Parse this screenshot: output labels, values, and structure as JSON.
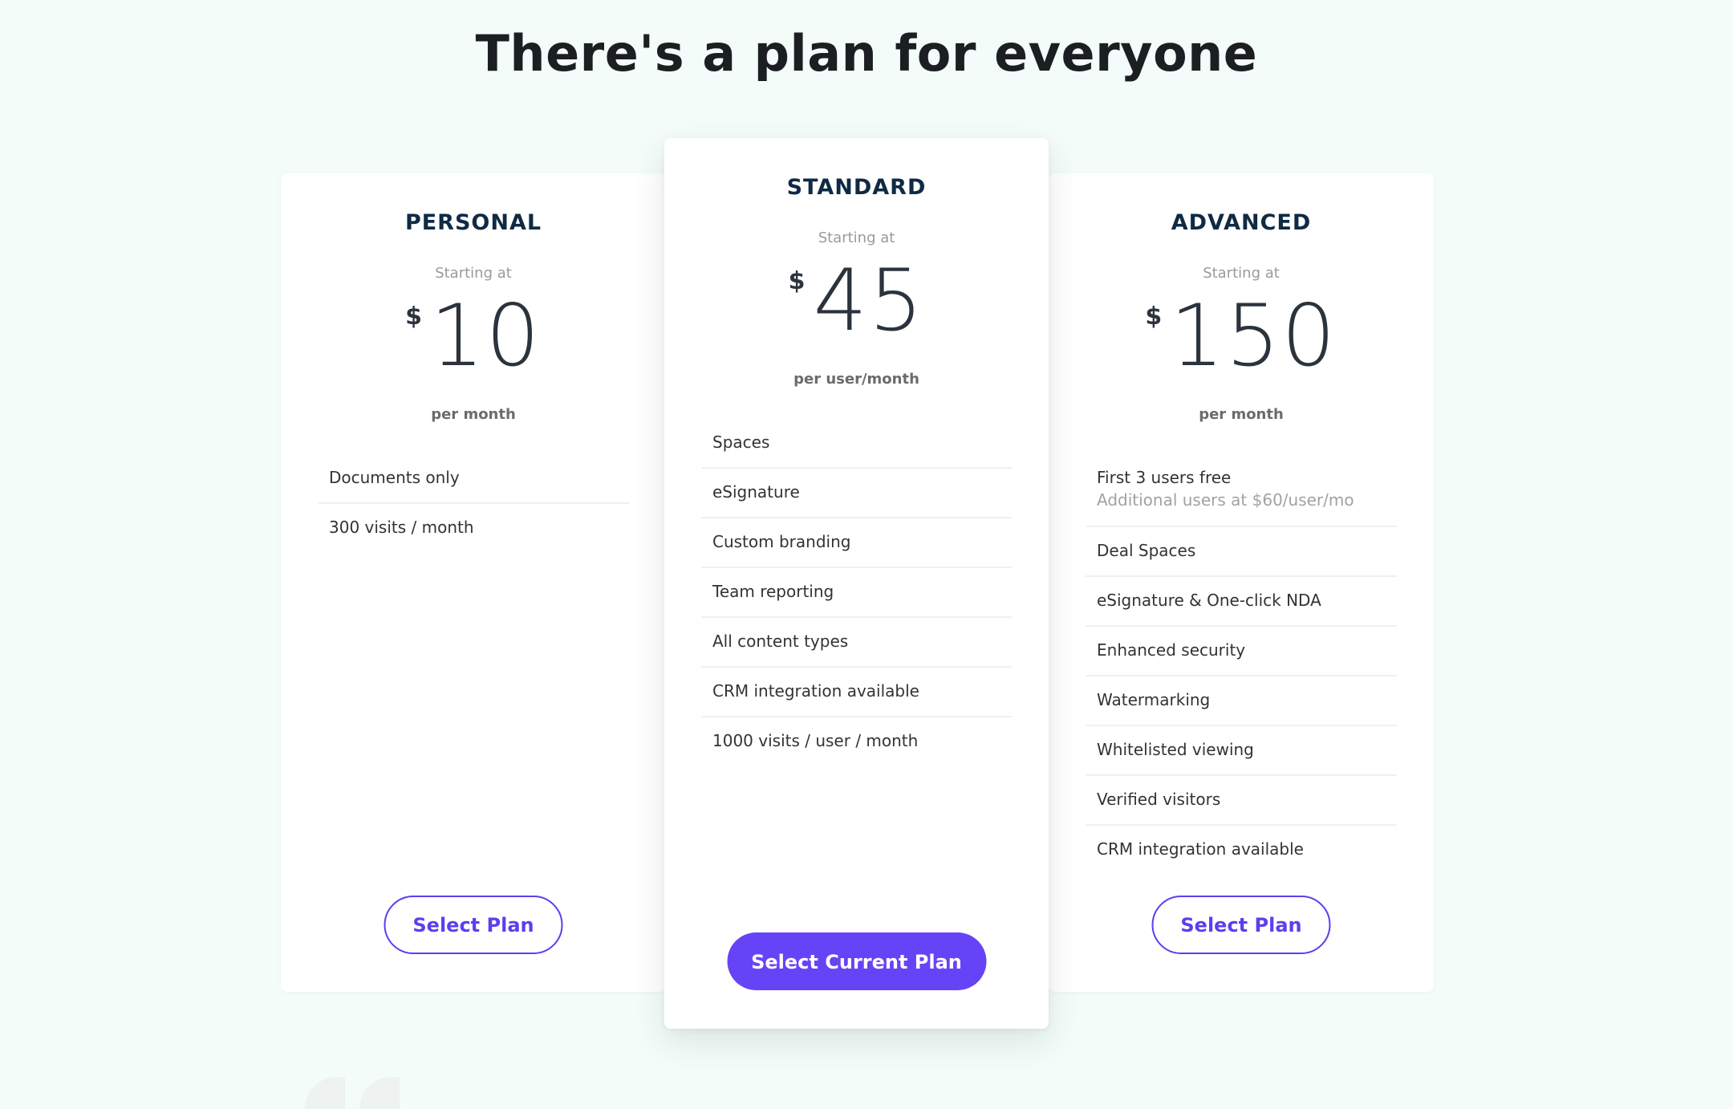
{
  "page": {
    "title": "There's a plan for everyone"
  },
  "colors": {
    "accent": "#6544F7",
    "outline_accent": "#5B3FF0",
    "background": "#F3FCF9",
    "plan_name": "#0F2A44"
  },
  "plans": [
    {
      "name": "PERSONAL",
      "starting_label": "Starting at",
      "currency": "$",
      "amount": "10",
      "period": "per month",
      "features": [
        {
          "text": "Documents only"
        },
        {
          "text": "300 visits / month"
        }
      ],
      "button_label": "Select Plan",
      "featured": false
    },
    {
      "name": "STANDARD",
      "starting_label": "Starting at",
      "currency": "$",
      "amount": "45",
      "period": "per user/month",
      "features": [
        {
          "text": "Spaces"
        },
        {
          "text": "eSignature"
        },
        {
          "text": "Custom branding"
        },
        {
          "text": "Team reporting"
        },
        {
          "text": "All content types"
        },
        {
          "text": "CRM integration available"
        },
        {
          "text": "1000 visits / user / month"
        }
      ],
      "button_label": "Select Current Plan",
      "featured": true
    },
    {
      "name": "ADVANCED",
      "starting_label": "Starting at",
      "currency": "$",
      "amount": "150",
      "period": "per month",
      "features": [
        {
          "text": "First 3 users free",
          "subtext": "Additional users at $60/user/mo"
        },
        {
          "text": "Deal Spaces"
        },
        {
          "text": "eSignature & One-click NDA"
        },
        {
          "text": "Enhanced security"
        },
        {
          "text": "Watermarking"
        },
        {
          "text": "Whitelisted viewing"
        },
        {
          "text": "Verified visitors"
        },
        {
          "text": "CRM integration available"
        }
      ],
      "button_label": "Select Plan",
      "featured": false
    }
  ]
}
